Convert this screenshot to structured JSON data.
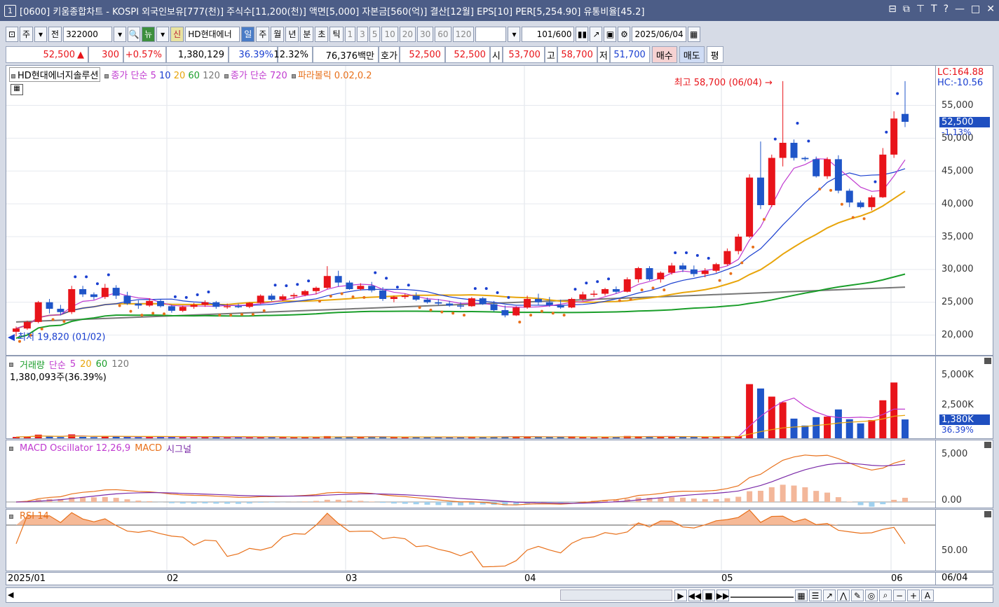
{
  "window": {
    "title": "[0600] 키움종합차트 - KOSPI 외국인보유[777(천)] 주식수[11,200(천)] 액면[5,000] 자본금[560(억)] 결산[12월] EPS[10] PER[5,254.90] 유통비율[45.2]",
    "index": "1",
    "controls": [
      "⊟",
      "⧉",
      "⊤",
      "T",
      "?",
      "—",
      "□",
      "✕"
    ]
  },
  "toolbar": {
    "period_type": "주",
    "prev_label": "전",
    "code": "322000",
    "news": "뉴",
    "new_label": "신",
    "stock_name": "HD현대에너",
    "intervals": [
      "일",
      "주",
      "월",
      "년",
      "분",
      "초",
      "틱"
    ],
    "selected_interval": "일",
    "minutes": [
      "1",
      "3",
      "5",
      "10",
      "20",
      "30",
      "60",
      "120"
    ],
    "count": "101",
    "total": "/600",
    "date": "2025/06/04"
  },
  "quote": {
    "price": "52,500",
    "arrow": "▲",
    "change": "300",
    "rate": "+0.57%",
    "volume": "1,380,129",
    "vol_ratio": "36.39%",
    "turnover": "12.32%",
    "amount": "76,376백만",
    "ask_label": "호가",
    "ask1": "52,500",
    "ask2": "52,500",
    "open_label": "시",
    "open": "53,700",
    "high_label": "고",
    "high": "58,700",
    "low_label": "저",
    "low": "51,700",
    "buy": "매수",
    "sell": "매도",
    "avg": "평"
  },
  "main_legend": {
    "name": "HD현대에너지솔루션",
    "ma_label": "종가 단순",
    "ma": [
      "5",
      "10",
      "20",
      "60",
      "120"
    ],
    "ma_colors": [
      "#c03ad0",
      "#1a3fd0",
      "#e8a50b",
      "#1a9e2a",
      "#777777"
    ],
    "ma2": "종가 단순 720",
    "parabolic": "파라볼릭 0.02,0.2"
  },
  "price_axis": {
    "labels": [
      "55,000",
      "50,000",
      "45,000",
      "40,000",
      "35,000",
      "30,000",
      "25,000",
      "20,000"
    ],
    "lc": "LC:164.88",
    "hc": "HC:-10.56",
    "current": "52,500",
    "current_rate": "-1.13%"
  },
  "annotations": {
    "high": "최고 58,700 (06/04)",
    "low": "최저 19,820 (01/02)"
  },
  "volume": {
    "title": "거래량",
    "ma_label": "단순",
    "ma": [
      "5",
      "20",
      "60",
      "120"
    ],
    "info": "1,380,093주(36.39%)",
    "axis": [
      "5,000K",
      "2,500K"
    ],
    "current": "1,380K",
    "current_rate": "36.39%"
  },
  "macd": {
    "title": "MACD Oscillator 12,26,9",
    "macd": "MACD",
    "signal": "시그널",
    "axis": [
      "5,000",
      "0.00"
    ]
  },
  "rsi": {
    "title": "RSI 14",
    "axis": [
      "50.00"
    ]
  },
  "xaxis": {
    "labels": [
      "2025/01",
      "02",
      "03",
      "04",
      "05",
      "06"
    ],
    "right": "06/04"
  },
  "chart_data": {
    "type": "candlestick",
    "title": "HD현대에너지솔루션",
    "ylim": [
      17500,
      60500
    ],
    "candles": [
      [
        20500,
        21300,
        19820,
        21000
      ],
      [
        21000,
        22200,
        20800,
        22000
      ],
      [
        22000,
        25200,
        21800,
        25000
      ],
      [
        25000,
        25500,
        23300,
        24000
      ],
      [
        24000,
        24600,
        23000,
        23500
      ],
      [
        23500,
        27500,
        23200,
        27000
      ],
      [
        27000,
        27500,
        25800,
        26200
      ],
      [
        26200,
        26500,
        25400,
        25800
      ],
      [
        25800,
        27800,
        25500,
        27200
      ],
      [
        27200,
        27600,
        25500,
        26000
      ],
      [
        26000,
        26600,
        24600,
        24800
      ],
      [
        24800,
        25300,
        24000,
        24500
      ],
      [
        24500,
        25600,
        24300,
        25200
      ],
      [
        25200,
        25500,
        24200,
        24400
      ],
      [
        24400,
        24600,
        23400,
        23700
      ],
      [
        23700,
        24500,
        23500,
        24300
      ],
      [
        24300,
        24900,
        24000,
        24600
      ],
      [
        24600,
        25300,
        24300,
        25000
      ],
      [
        25000,
        25200,
        24000,
        24300
      ],
      [
        24300,
        24800,
        24000,
        24400
      ],
      [
        24400,
        24800,
        24100,
        24300
      ],
      [
        24300,
        25000,
        24100,
        24900
      ],
      [
        24900,
        26200,
        24700,
        26000
      ],
      [
        26000,
        26300,
        25200,
        25400
      ],
      [
        25400,
        26200,
        25200,
        25900
      ],
      [
        25900,
        26400,
        25500,
        26100
      ],
      [
        26100,
        26900,
        25900,
        26700
      ],
      [
        26700,
        27400,
        26200,
        27200
      ],
      [
        27200,
        30500,
        27000,
        29000
      ],
      [
        29000,
        29800,
        27400,
        28000
      ],
      [
        28000,
        28300,
        26900,
        27000
      ],
      [
        27000,
        27900,
        26800,
        27500
      ],
      [
        27500,
        28100,
        26500,
        26800
      ],
      [
        26800,
        27300,
        25200,
        25500
      ],
      [
        25500,
        26000,
        25000,
        25800
      ],
      [
        25800,
        26300,
        25500,
        26000
      ],
      [
        26000,
        26500,
        25200,
        25400
      ],
      [
        25400,
        25700,
        24800,
        25000
      ],
      [
        25000,
        25500,
        24500,
        24800
      ],
      [
        24800,
        25200,
        24300,
        24500
      ],
      [
        24500,
        25000,
        24000,
        24400
      ],
      [
        24400,
        25800,
        24300,
        25600
      ],
      [
        25600,
        25800,
        24600,
        24700
      ],
      [
        24700,
        25200,
        23600,
        23800
      ],
      [
        23800,
        24500,
        22700,
        23000
      ],
      [
        23000,
        24400,
        22900,
        24200
      ],
      [
        24200,
        26000,
        24000,
        25500
      ],
      [
        25500,
        26300,
        24600,
        25000
      ],
      [
        25000,
        25800,
        24300,
        24600
      ],
      [
        24600,
        25400,
        24000,
        24200
      ],
      [
        24200,
        25700,
        24100,
        25500
      ],
      [
        25500,
        26600,
        25200,
        26200
      ],
      [
        26200,
        26800,
        25800,
        26300
      ],
      [
        26300,
        27200,
        26000,
        27000
      ],
      [
        27000,
        27400,
        26300,
        26600
      ],
      [
        26600,
        28800,
        26500,
        28500
      ],
      [
        28500,
        30400,
        28000,
        30200
      ],
      [
        30200,
        30500,
        28300,
        28500
      ],
      [
        28500,
        29700,
        28000,
        29500
      ],
      [
        29500,
        31000,
        29200,
        30600
      ],
      [
        30600,
        31000,
        29600,
        30000
      ],
      [
        30000,
        30600,
        28900,
        29300
      ],
      [
        29300,
        30200,
        28800,
        29800
      ],
      [
        29800,
        31000,
        29500,
        30800
      ],
      [
        30800,
        33200,
        30600,
        32800
      ],
      [
        32800,
        35400,
        32300,
        35000
      ],
      [
        35000,
        44500,
        34800,
        44000
      ],
      [
        44000,
        49500,
        39200,
        39800
      ],
      [
        39800,
        47500,
        39500,
        47000
      ],
      [
        47000,
        58700,
        45700,
        49300
      ],
      [
        49300,
        49800,
        46600,
        47000
      ],
      [
        47000,
        47200,
        46500,
        46800
      ],
      [
        46800,
        47200,
        44000,
        44200
      ],
      [
        44200,
        47100,
        43800,
        46800
      ],
      [
        46800,
        47400,
        41600,
        42000
      ],
      [
        42000,
        42300,
        39500,
        40200
      ],
      [
        40200,
        40500,
        39300,
        39500
      ],
      [
        39500,
        41300,
        39000,
        41000
      ],
      [
        41000,
        48500,
        40900,
        47500
      ],
      [
        47500,
        54100,
        47000,
        53000
      ],
      [
        53700,
        58700,
        51700,
        52500
      ]
    ],
    "ma5_last": 46000,
    "ma20_last": 41500,
    "ma60_last": 31000,
    "ma120_last": 27300,
    "volume_last": 1380129,
    "rsi_last": 50
  }
}
